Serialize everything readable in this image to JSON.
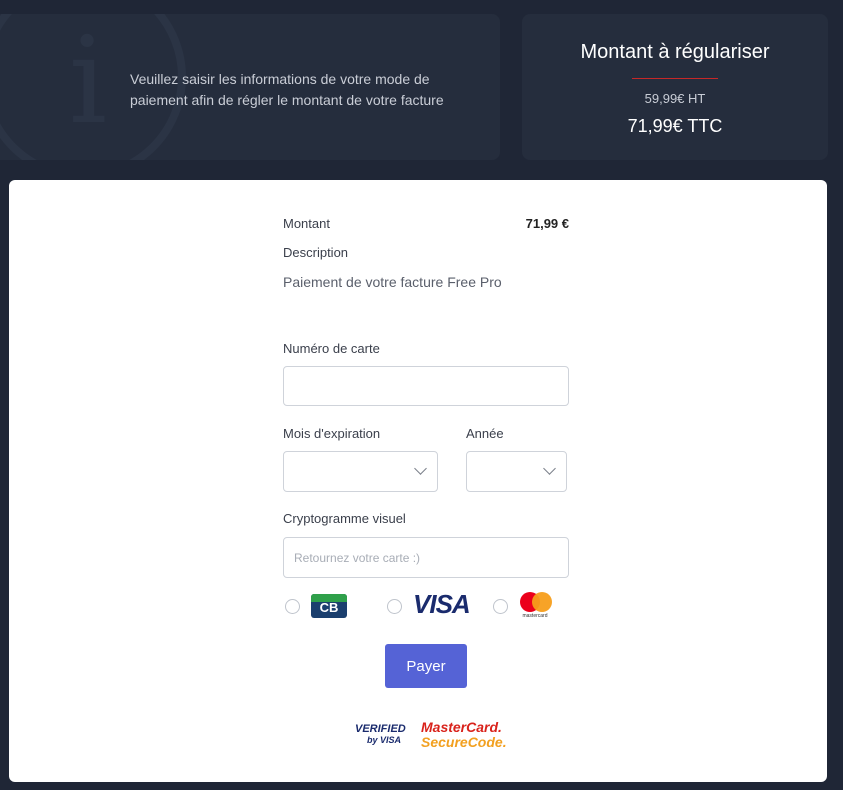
{
  "info": {
    "message": "Veuillez saisir les informations de votre mode de paiement afin de régler le montant de votre facture"
  },
  "amount_panel": {
    "title": "Montant à régulariser",
    "ht": "59,99€ HT",
    "ttc": "71,99€ TTC",
    "divider_color": "#c62828"
  },
  "summary": {
    "montant_label": "Montant",
    "montant_value": "71,99 €",
    "description_label": "Description",
    "description_value": "Paiement de votre facture Free Pro"
  },
  "form": {
    "card_number_label": "Numéro de carte",
    "card_number_value": "",
    "expiry_month_label": "Mois d'expiration",
    "expiry_month_value": "",
    "expiry_year_label": "Année",
    "expiry_year_value": "",
    "cvv_label": "Cryptogramme visuel",
    "cvv_placeholder": "Retournez votre carte :)"
  },
  "card_types": [
    {
      "name": "cb",
      "label": "CB",
      "icon": "cb-logo",
      "selected": false
    },
    {
      "name": "visa",
      "label": "VISA",
      "icon": "visa-logo",
      "selected": false
    },
    {
      "name": "mastercard",
      "label": "mastercard",
      "icon": "mastercard-logo",
      "selected": false
    }
  ],
  "pay_button": {
    "label": "Payer",
    "color": "#5563d6"
  },
  "security_logos": {
    "vbv_line1": "VERIFIED",
    "vbv_line2": "by VISA",
    "mcsc_line1": "MasterCard.",
    "mcsc_line2": "SecureCode."
  },
  "colors": {
    "background": "#1f2636",
    "panel": "#252d3d",
    "accent": "#5563d6"
  }
}
